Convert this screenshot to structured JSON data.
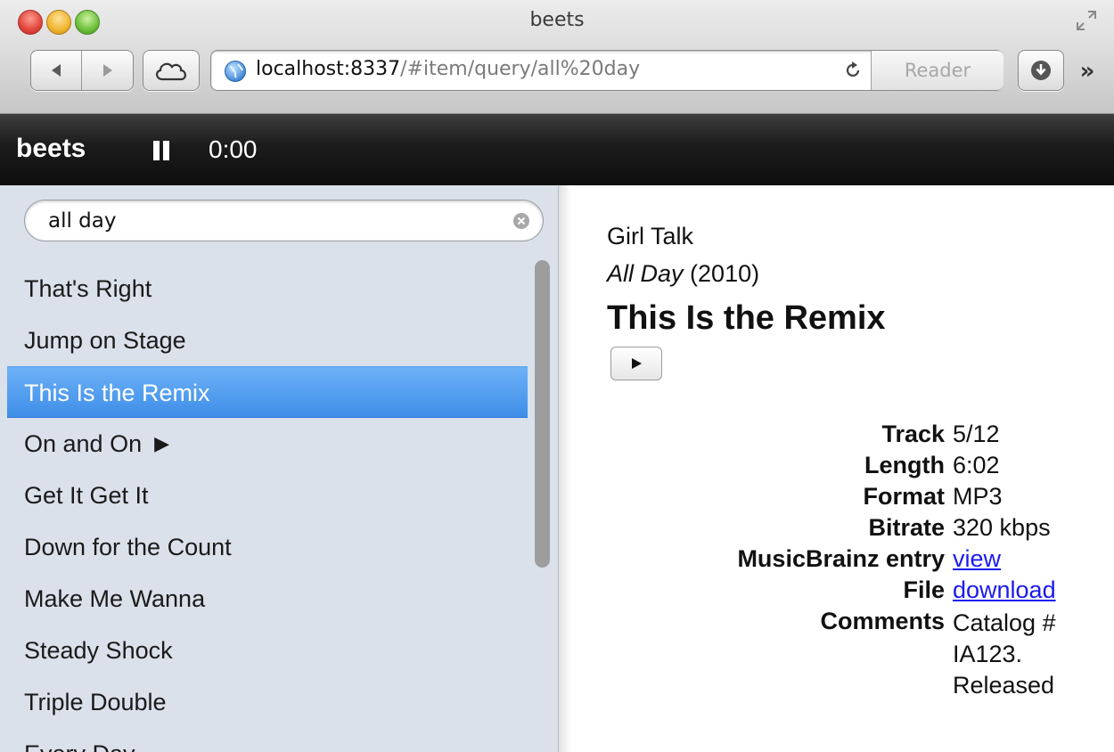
{
  "window": {
    "title": "beets"
  },
  "browser": {
    "url_host": "localhost:8337",
    "url_path": "/#item/query/all%20day",
    "reader_label": "Reader",
    "overflow_label": "»"
  },
  "header": {
    "brand": "beets",
    "time": "0:00"
  },
  "search": {
    "value": "all day"
  },
  "results": [
    {
      "label": "That's Right"
    },
    {
      "label": "Jump on Stage"
    },
    {
      "label": "This Is the Remix",
      "selected": true
    },
    {
      "label": "On and On",
      "playing": true
    },
    {
      "label": "Get It Get It"
    },
    {
      "label": "Down for the Count"
    },
    {
      "label": "Make Me Wanna"
    },
    {
      "label": "Steady Shock"
    },
    {
      "label": "Triple Double"
    },
    {
      "label": "Every Day"
    }
  ],
  "detail": {
    "artist": "Girl Talk",
    "album": "All Day",
    "year": "(2010)",
    "title": "This Is the Remix",
    "meta": {
      "track_label": "Track",
      "track_value": "5/12",
      "length_label": "Length",
      "length_value": "6:02",
      "format_label": "Format",
      "format_value": "MP3",
      "bitrate_label": "Bitrate",
      "bitrate_value": "320 kbps",
      "mb_label": "MusicBrainz entry",
      "mb_value": "view",
      "file_label": "File",
      "file_value": "download",
      "comments_label": "Comments",
      "comments_value": "Catalog # IA123. Released"
    }
  },
  "colors": {
    "selection": "#3e8ee8",
    "sidebar_bg": "#dbe1eb",
    "header_bg": "#1b1b1b",
    "link": "#1a1aee"
  }
}
